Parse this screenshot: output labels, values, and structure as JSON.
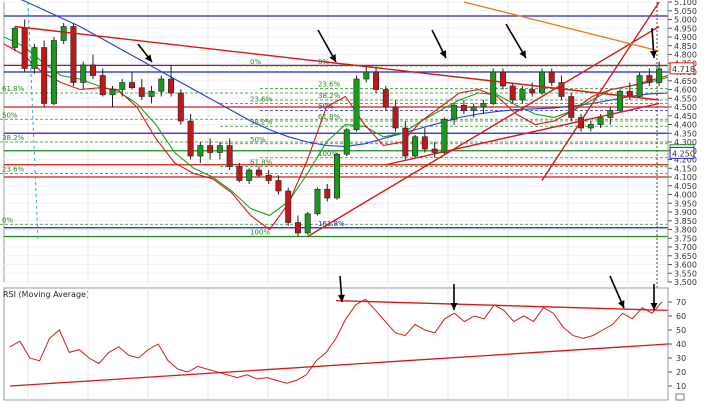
{
  "chart_data": [
    {
      "type": "candlestick",
      "title": "",
      "ylim": [
        3500,
        5100
      ],
      "y_ticks": [
        "5.100",
        "5.050",
        "5.000",
        "4.950",
        "4.900",
        "4.850",
        "4.800",
        "4.750",
        "4.700",
        "4.650",
        "4.600",
        "4.550",
        "4.500",
        "4.450",
        "4.400",
        "4.350",
        "4.300",
        "4.250",
        "4.200",
        "4.150",
        "4.100",
        "4.050",
        "4.000",
        "3.950",
        "3.900",
        "3.850",
        "3.800",
        "3.750",
        "3.700",
        "3.650",
        "3.600",
        "3.550",
        "3.500"
      ],
      "y_tick_values": [
        5100,
        5050,
        5000,
        4950,
        4900,
        4850,
        4800,
        4750,
        4700,
        4650,
        4600,
        4550,
        4500,
        4450,
        4400,
        4350,
        4300,
        4250,
        4200,
        4150,
        4100,
        4050,
        4000,
        3950,
        3900,
        3850,
        3800,
        3750,
        3700,
        3650,
        3600,
        3550,
        3500
      ],
      "price_tags": [
        {
          "text": "4.718",
          "value": 4718,
          "color": "#d21a1a"
        },
        {
          "text": "4.250",
          "value": 4250,
          "color": "#1a8a1a"
        },
        {
          "text": "4.250",
          "value": 4235,
          "color": "#2222cc"
        }
      ],
      "candles": [
        [
          4840,
          4960,
          4820,
          4950
        ],
        [
          4950,
          5000,
          4700,
          4720
        ],
        [
          4720,
          4860,
          4690,
          4840
        ],
        [
          4840,
          4880,
          4500,
          4520
        ],
        [
          4520,
          4900,
          4510,
          4880
        ],
        [
          4880,
          4980,
          4860,
          4960
        ],
        [
          4960,
          4980,
          4620,
          4640
        ],
        [
          4640,
          4760,
          4600,
          4740
        ],
        [
          4740,
          4800,
          4660,
          4680
        ],
        [
          4680,
          4720,
          4560,
          4570
        ],
        [
          4570,
          4620,
          4500,
          4600
        ],
        [
          4600,
          4660,
          4560,
          4640
        ],
        [
          4640,
          4700,
          4600,
          4610
        ],
        [
          4610,
          4660,
          4540,
          4560
        ],
        [
          4560,
          4620,
          4520,
          4590
        ],
        [
          4590,
          4680,
          4560,
          4660
        ],
        [
          4660,
          4740,
          4560,
          4580
        ],
        [
          4580,
          4600,
          4400,
          4420
        ],
        [
          4420,
          4460,
          4200,
          4220
        ],
        [
          4220,
          4300,
          4180,
          4280
        ],
        [
          4280,
          4320,
          4200,
          4240
        ],
        [
          4240,
          4300,
          4200,
          4280
        ],
        [
          4280,
          4320,
          4140,
          4160
        ],
        [
          4160,
          4180,
          4070,
          4080
        ],
        [
          4080,
          4150,
          4060,
          4140
        ],
        [
          4140,
          4160,
          4100,
          4110
        ],
        [
          4110,
          4140,
          4060,
          4080
        ],
        [
          4080,
          4110,
          4000,
          4020
        ],
        [
          4020,
          4040,
          3820,
          3840
        ],
        [
          3840,
          3880,
          3760,
          3780
        ],
        [
          3780,
          3900,
          3770,
          3890
        ],
        [
          3890,
          4040,
          3880,
          4030
        ],
        [
          4030,
          4060,
          3960,
          3980
        ],
        [
          3980,
          4240,
          3970,
          4230
        ],
        [
          4230,
          4380,
          4220,
          4370
        ],
        [
          4370,
          4680,
          4360,
          4660
        ],
        [
          4660,
          4740,
          4640,
          4700
        ],
        [
          4700,
          4720,
          4580,
          4600
        ],
        [
          4600,
          4620,
          4480,
          4500
        ],
        [
          4500,
          4540,
          4360,
          4380
        ],
        [
          4380,
          4420,
          4200,
          4220
        ],
        [
          4220,
          4340,
          4210,
          4330
        ],
        [
          4330,
          4380,
          4240,
          4260
        ],
        [
          4260,
          4300,
          4210,
          4240
        ],
        [
          4240,
          4440,
          4230,
          4430
        ],
        [
          4430,
          4520,
          4400,
          4510
        ],
        [
          4510,
          4540,
          4460,
          4480
        ],
        [
          4480,
          4520,
          4440,
          4500
        ],
        [
          4500,
          4540,
          4460,
          4520
        ],
        [
          4520,
          4720,
          4510,
          4700
        ],
        [
          4700,
          4720,
          4600,
          4620
        ],
        [
          4620,
          4640,
          4520,
          4540
        ],
        [
          4540,
          4620,
          4520,
          4600
        ],
        [
          4600,
          4640,
          4560,
          4580
        ],
        [
          4580,
          4720,
          4570,
          4700
        ],
        [
          4700,
          4720,
          4620,
          4640
        ],
        [
          4640,
          4680,
          4540,
          4560
        ],
        [
          4560,
          4580,
          4420,
          4440
        ],
        [
          4440,
          4460,
          4360,
          4380
        ],
        [
          4380,
          4420,
          4360,
          4400
        ],
        [
          4400,
          4460,
          4380,
          4440
        ],
        [
          4440,
          4500,
          4400,
          4480
        ],
        [
          4480,
          4600,
          4470,
          4590
        ],
        [
          4590,
          4640,
          4540,
          4560
        ],
        [
          4560,
          4700,
          4550,
          4680
        ],
        [
          4680,
          4720,
          4620,
          4640
        ],
        [
          4640,
          4760,
          4620,
          4718
        ]
      ],
      "moving_averages": [
        {
          "color": "#1f3fd0",
          "values": [
            5150,
            5110,
            5060,
            5010,
            4960,
            4900,
            4840,
            4780,
            4720,
            4660,
            4600,
            4540,
            4480,
            4420,
            4370,
            4330,
            4300,
            4280,
            4275,
            4290,
            4320,
            4350,
            4380,
            4410,
            4440,
            4460,
            4475,
            4485,
            4490,
            4495,
            4505,
            4520,
            4540,
            4560,
            4575,
            4580
          ]
        },
        {
          "color": "#19a019",
          "values": [
            4900,
            4850,
            4760,
            4680,
            4660,
            4620,
            4590,
            4520,
            4400,
            4240,
            4150,
            4100,
            4020,
            3920,
            3880,
            3960,
            4120,
            4300,
            4400,
            4390,
            4330,
            4350,
            4420,
            4480,
            4540,
            4580,
            4570,
            4510,
            4460,
            4440,
            4480,
            4540,
            4600,
            4620,
            4640,
            4670
          ]
        },
        {
          "color": "#d21a1a",
          "values": [
            4860,
            4800,
            4700,
            4640,
            4600,
            4610,
            4600,
            4500,
            4320,
            4180,
            4120,
            4090,
            4010,
            3880,
            3800,
            3950,
            4200,
            4500,
            4560,
            4400,
            4280,
            4300,
            4420,
            4500,
            4580,
            4600,
            4560,
            4460,
            4400,
            4420,
            4480,
            4560,
            4600,
            4620,
            4650,
            4680
          ]
        }
      ],
      "fibonacci_retracements": [
        {
          "labels": [
            "0%",
            "23.6%",
            "38.2%",
            "50%",
            "61.8%",
            "100%",
            "161.8%"
          ],
          "values": [
            4735,
            4605,
            4540,
            4480,
            4420,
            4210,
            3810
          ],
          "colors": [
            "#2a8a2a",
            "#2a8a2a",
            "#2a8a2a",
            "#2222cc",
            "#2a8a2a",
            "#2a8a2a",
            "#2222cc"
          ]
        },
        {
          "labels": [
            "0%",
            "23.6%",
            "38.2%",
            "50%",
            "61.8%",
            "100%"
          ],
          "values": [
            4735,
            4520,
            4390,
            4290,
            4160,
            3760
          ],
          "colors": [
            "#2a8a2a",
            "#2a8a2a",
            "#2a8a2a",
            "#2a8a2a",
            "#2a8a2a",
            "#2a8a2a"
          ]
        },
        {
          "labels": [
            "61.8%",
            "50%",
            "38.2%",
            "23.6%",
            "0%"
          ],
          "values": [
            4580,
            4430,
            4300,
            4120,
            3830
          ],
          "colors": [
            "#2a8a2a",
            "#2a8a2a",
            "#2a8a2a",
            "#2a8a2a",
            "#2a8a2a"
          ]
        }
      ],
      "horizontal_levels": [
        {
          "value": 5020,
          "color": "#2222cc"
        },
        {
          "value": 4738,
          "color": "#8a1a5a"
        },
        {
          "value": 4700,
          "color": "#2222cc"
        },
        {
          "value": 4500,
          "color": "#d21a1a"
        },
        {
          "value": 4350,
          "color": "#2222cc"
        },
        {
          "value": 4250,
          "color": "#1a8a1a"
        },
        {
          "value": 4170,
          "color": "#d21a1a"
        },
        {
          "value": 4100,
          "color": "#d21a1a"
        },
        {
          "value": 3810,
          "color": "#2222cc"
        },
        {
          "value": 3760,
          "color": "#1a8a1a"
        }
      ],
      "trendlines": [
        {
          "from": [
            0,
            4960
          ],
          "to": [
            66,
            4540
          ],
          "color": "#d21a1a"
        },
        {
          "from": [
            30,
            3760
          ],
          "to": [
            66,
            4960
          ],
          "color": "#d21a1a"
        },
        {
          "from": [
            38,
            4170
          ],
          "to": [
            66,
            4520
          ],
          "color": "#d21a1a"
        },
        {
          "from": [
            54,
            4080
          ],
          "to": [
            66,
            5100
          ],
          "color": "#d21a1a"
        },
        {
          "from": [
            46,
            5100
          ],
          "to": [
            66,
            4820
          ],
          "color": "#e87d1a"
        }
      ],
      "annotations": [
        "arrow-down",
        "arrow-down",
        "arrow-down",
        "arrow-down",
        "arrow-down",
        "arrow-down"
      ]
    },
    {
      "type": "line",
      "title": "RSI (Moving Average)",
      "ylim": [
        0,
        80
      ],
      "y_ticks": [
        "70",
        "60",
        "50",
        "40",
        "30",
        "20",
        "10"
      ],
      "y_tick_values": [
        70,
        60,
        50,
        40,
        30,
        20,
        10
      ],
      "series": [
        {
          "color": "#d21a1a",
          "values": [
            38,
            42,
            30,
            28,
            44,
            50,
            34,
            36,
            30,
            26,
            34,
            38,
            32,
            30,
            36,
            40,
            28,
            22,
            20,
            24,
            22,
            20,
            18,
            16,
            18,
            15,
            16,
            14,
            12,
            14,
            18,
            28,
            34,
            44,
            58,
            68,
            72,
            64,
            56,
            48,
            46,
            54,
            50,
            48,
            58,
            62,
            56,
            60,
            58,
            68,
            64,
            56,
            60,
            56,
            66,
            62,
            52,
            46,
            44,
            46,
            50,
            54,
            62,
            58,
            66,
            62,
            70
          ]
        }
      ],
      "trendlines": [
        {
          "from": [
            0,
            10
          ],
          "to": [
            66,
            40
          ],
          "color": "#d21a1a"
        },
        {
          "from": [
            33,
            71
          ],
          "to": [
            66,
            64
          ],
          "color": "#d21a1a"
        }
      ],
      "annotations": [
        "arrow-down",
        "arrow-down",
        "arrow-down",
        "arrow-down"
      ]
    }
  ]
}
